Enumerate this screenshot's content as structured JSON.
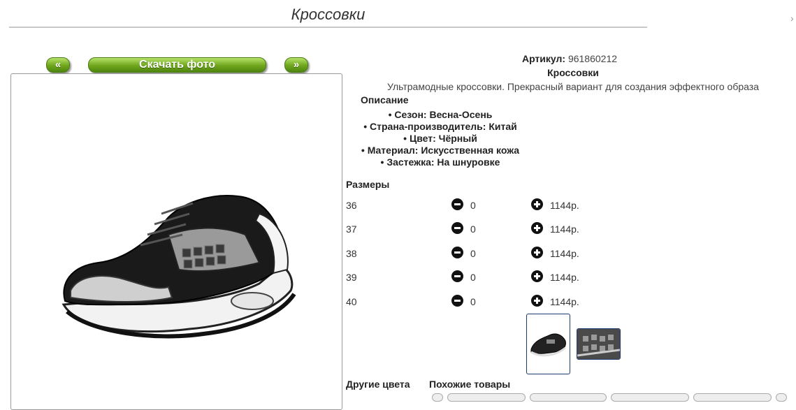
{
  "page": {
    "title": "Кроссовки"
  },
  "nav": {
    "prev_label": "«",
    "download_label": "Скачать фото",
    "next_label": "»"
  },
  "product": {
    "article_label": "Артикул:",
    "article_value": "961860212",
    "name": "Кроссовки",
    "tagline": "Ультрамодные кроссовки. Прекрасный вариант для создания эффектного образа",
    "description_heading": "Описание",
    "specs": [
      "Сезон: Весна-Осень",
      "Страна-производитель: Китай",
      "Цвет: Чёрный",
      "Материал: Искусственная кожа",
      "Застежка: На шнуровке"
    ]
  },
  "sizes": {
    "heading": "Размеры",
    "rows": [
      {
        "size": "36",
        "qty": "0",
        "price": "1144р."
      },
      {
        "size": "37",
        "qty": "0",
        "price": "1144р."
      },
      {
        "size": "38",
        "qty": "0",
        "price": "1144р."
      },
      {
        "size": "39",
        "qty": "0",
        "price": "1144р."
      },
      {
        "size": "40",
        "qty": "0",
        "price": "1144р."
      }
    ]
  },
  "sections": {
    "other_colors": "Другие цвета",
    "similar": "Похожие товары"
  },
  "icons": {
    "decrease": "minus-circle-icon",
    "increase": "plus-circle-icon"
  },
  "colors": {
    "button_green": "#6fa51c",
    "thumb_border": "#1c3b6e"
  }
}
